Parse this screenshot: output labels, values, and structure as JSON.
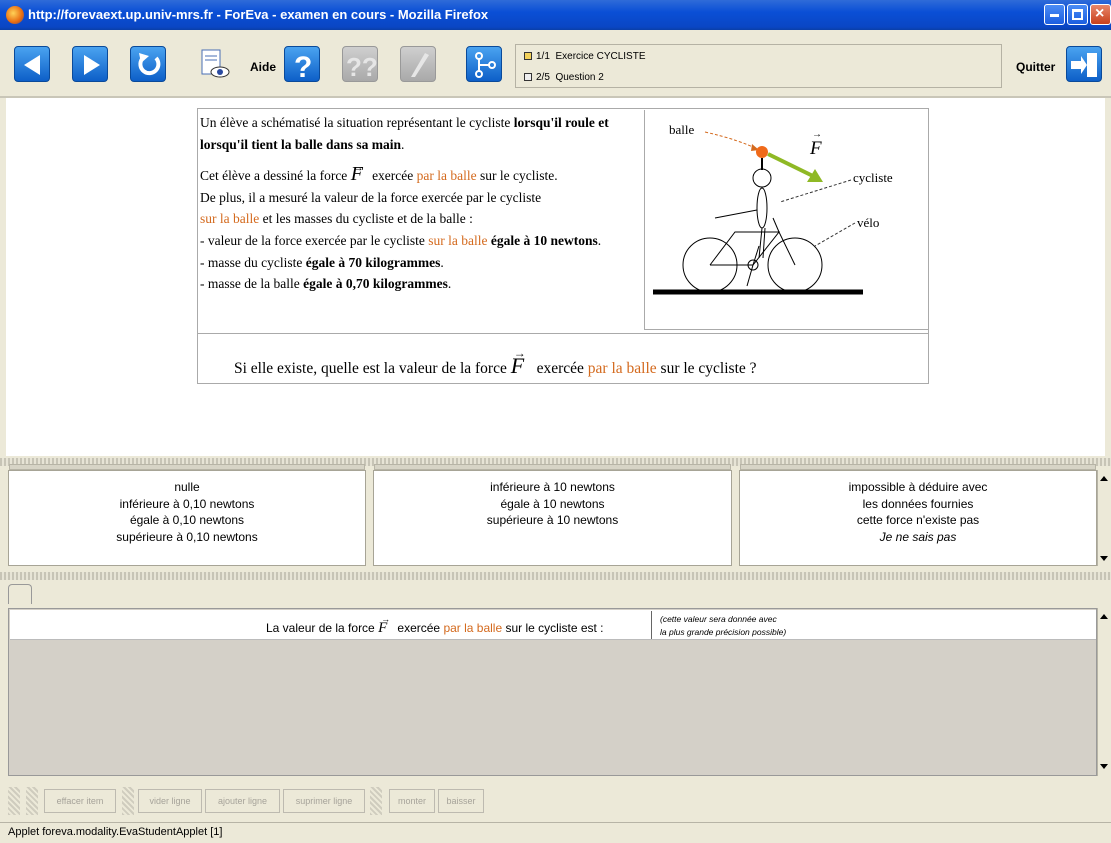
{
  "window": {
    "title": "http://forevaext.up.univ-mrs.fr - ForEva - examen en cours - Mozilla Firefox"
  },
  "toolbar": {
    "aide_label": "Aide",
    "quitter_label": "Quitter",
    "exercise": {
      "counter": "1/1",
      "name": "Exercice CYCLISTE"
    },
    "question": {
      "counter": "2/5",
      "name": "Question 2"
    }
  },
  "problem": {
    "p1": {
      "t1": "Un élève a schématisé la situation représentant le cycliste ",
      "b1": "lorsqu'il roule et lorsqu'il tient la balle dans sa main",
      "t2": "."
    },
    "p2": {
      "t1": "Cet élève a dessiné la force ",
      "force_symbol": "F",
      "t2": " exercée ",
      "o1": "par la balle",
      "t3": " sur le cycliste.",
      "t4": "De plus, il a mesuré la valeur de la force exercée par le cycliste ",
      "o2": "sur la balle",
      "t5": " et les masses du cycliste et de la balle :",
      "t6": "- valeur de la force exercée par le cycliste ",
      "o3": "sur la balle",
      "b1": " égale à 10 newtons",
      "t7": ".",
      "t8": "- masse du cycliste ",
      "b2": "égale à 70 kilogrammes",
      "t9": ".",
      "t10": "- masse de la balle ",
      "b3": "égale à 0,70 kilogrammes",
      "t11": "."
    },
    "figure_labels": {
      "balle": "balle",
      "force": "F",
      "cycliste": "cycliste",
      "velo": "vélo"
    },
    "question": {
      "t1": "Si elle existe, quelle est la valeur de la force ",
      "force_symbol": "F",
      "t2": " exercée ",
      "o1": "par la balle",
      "t3": " sur le cycliste ?"
    }
  },
  "choices": {
    "col1": [
      "nulle",
      "inférieure à 0,10 newtons",
      "égale à 0,10 newtons",
      "supérieure à 0,10 newtons"
    ],
    "col2": [
      "inférieure à 10 newtons",
      "égale à 10 newtons",
      "supérieure à 10 newtons"
    ],
    "col3": [
      "impossible à déduire avec",
      "les données fournies",
      "cette force n'existe pas",
      "Je ne sais pas"
    ]
  },
  "answer": {
    "t1": "La valeur de la force ",
    "force_symbol": "F",
    "t2": " exercée ",
    "o1": "par la balle",
    "t3": " sur le cycliste est :",
    "hint1": "(cette valeur sera donnée avec",
    "hint2": "la plus grande précision possible)"
  },
  "bottom_buttons": {
    "effacer": "effacer item",
    "vider": "vider ligne",
    "ajouter": "ajouter ligne",
    "suprimer": "suprimer ligne",
    "monter": "monter",
    "baisser": "baisser"
  },
  "status": "Applet foreva.modality.EvaStudentApplet [1]",
  "colors": {
    "orange_text": "#d46a1e",
    "force_arrow": "#8fb925",
    "ball": "#f06a1a"
  }
}
